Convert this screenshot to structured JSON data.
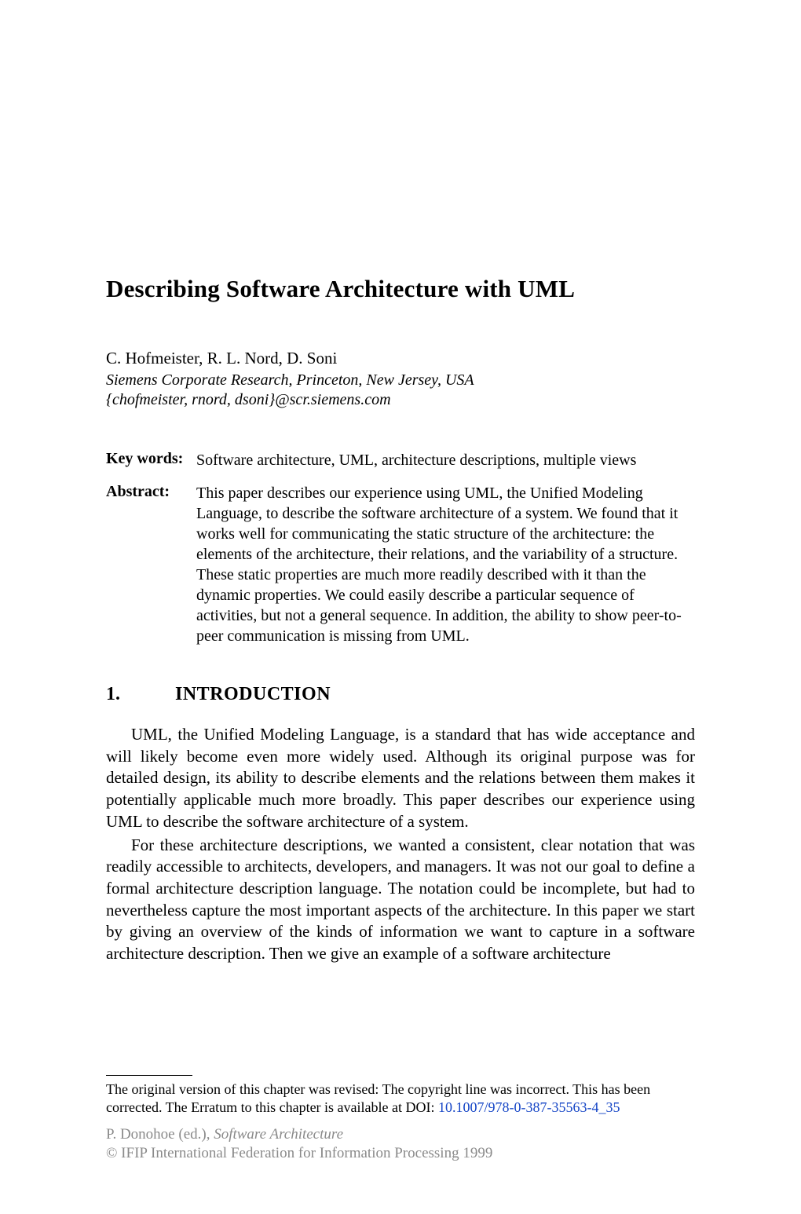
{
  "title": "Describing Software Architecture with UML",
  "authors": "C. Hofmeister, R. L. Nord, D. Soni",
  "affiliation": "Siemens Corporate Research, Princeton, New Jersey, USA",
  "emails": "{chofmeister, rnord, dsoni}@scr.siemens.com",
  "keywords": {
    "label": "Key words:",
    "text": "Software architecture, UML, architecture descriptions, multiple views"
  },
  "abstract": {
    "label": "Abstract:",
    "text": "This paper describes our experience using UML, the Unified Modeling Language, to describe the software architecture of a system. We found that it works well for communicating the static structure of the architecture: the elements of the architecture, their relations, and the variability of a structure. These static properties are much more readily described with it than the dynamic properties. We could easily describe a particular sequence of activities, but not a general sequence. In addition, the ability to show peer-to-peer communication is missing from UML."
  },
  "section": {
    "number": "1.",
    "title": "INTRODUCTION"
  },
  "paragraphs": [
    "UML, the Unified Modeling Language, is a standard that has wide acceptance and will likely become even more widely used. Although its original purpose was for detailed design, its ability to describe elements and the relations between them makes it potentially applicable much more broadly. This paper describes our experience using UML to describe the software architecture of a system.",
    "For these architecture descriptions, we wanted a consistent, clear notation that was readily accessible to architects, developers, and managers. It was not our goal to define a formal architecture description language. The notation could be incomplete, but had to nevertheless capture the most important aspects of the architecture. In this paper we start by giving an overview of the kinds of information we want to capture in a software architecture description. Then we give an example of a software architecture"
  ],
  "footnote": {
    "erratum_prefix": "The original version of this chapter was revised: The copyright line was incorrect. This has been corrected. The Erratum to this chapter is available at DOI: ",
    "doi": "10.1007/978-0-387-35563-4_35",
    "editor_prefix": "P. Donohoe (ed.), ",
    "book_title": "Software Architecture",
    "copyright": "© IFIP International Federation for Information Processing 1999"
  }
}
